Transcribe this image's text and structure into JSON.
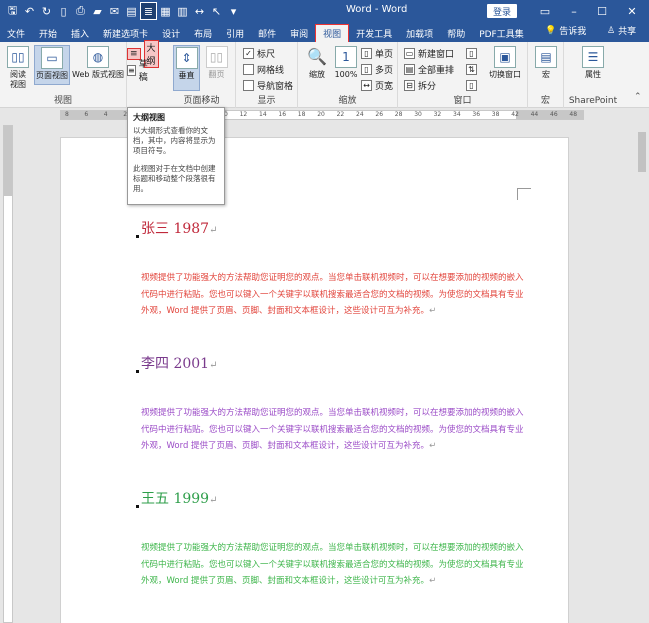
{
  "window": {
    "title": "Word - Word",
    "login_label": "登录",
    "controls": {
      "ribbon_options": "▭",
      "minimize": "–",
      "maximize": "☐",
      "close": "✕"
    }
  },
  "qat": [
    "save",
    "undo",
    "redo",
    "new",
    "print-preview",
    "open",
    "mail",
    "outline-view",
    "draft",
    "columns",
    "spacing",
    "select",
    "customize"
  ],
  "tabs": [
    "文件",
    "开始",
    "插入",
    "新建选项卡",
    "设计",
    "布局",
    "引用",
    "邮件",
    "审阅",
    "视图",
    "开发工具",
    "加载项",
    "帮助",
    "PDF工具集"
  ],
  "active_tab": "视图",
  "tab_right": {
    "tell_me": "告诉我",
    "share": "共享"
  },
  "ribbon": {
    "views": {
      "label": "视图",
      "read_mode": "阅读\n视图",
      "print_layout": "页面视图",
      "web_layout": "Web 版式视图",
      "outline": "大纲",
      "draft": "草稿"
    },
    "page_movement": {
      "label": "页面移动",
      "vertical": "垂直",
      "side_to_side": "翻页"
    },
    "show": {
      "label": "显示",
      "ruler": "标尺",
      "gridlines": "网格线",
      "nav_pane": "导航窗格",
      "ruler_checked": true
    },
    "zoom": {
      "label": "缩放",
      "zoom": "缩放",
      "percent": "100%",
      "one_page": "单页",
      "multi_page": "多页",
      "page_width": "页宽"
    },
    "window": {
      "label": "窗口",
      "new_window": "新建窗口",
      "arrange_all": "全部重排",
      "split": "拆分",
      "switch": "切换窗口"
    },
    "macros": {
      "label": "宏",
      "macros": "宏"
    },
    "sharepoint": {
      "label": "SharePoint",
      "properties": "属性"
    }
  },
  "ruler_ticks": [
    "8",
    "6",
    "4",
    "2",
    "2",
    "4",
    "6",
    "8",
    "10",
    "12",
    "14",
    "16",
    "18",
    "20",
    "22",
    "24",
    "26",
    "28",
    "30",
    "32",
    "34",
    "36",
    "38",
    "42",
    "44",
    "46",
    "48"
  ],
  "tooltip": {
    "title": "大纲视图",
    "p1": "以大纲形式查看你的文档，其中，内容将显示为项目符号。",
    "p2": "此视图对于在文档中创建标题和移动整个段落很有用。"
  },
  "document": {
    "sections": [
      {
        "heading": "张三 1987",
        "color": "#c0293b",
        "body": "视频提供了功能强大的方法帮助您证明您的观点。当您单击联机视频时，可以在想要添加的视频的嵌入代码中进行粘贴。您也可以键入一个关键字以联机搜索最适合您的文档的视频。为使您的文档具有专业外观，Word 提供了页眉、页脚、封面和文本框设计，这些设计可互为补充。",
        "body_color": "#e2453c"
      },
      {
        "heading": "李四 2001",
        "color": "#7a3a8c",
        "body": "视频提供了功能强大的方法帮助您证明您的观点。当您单击联机视频时，可以在想要添加的视频的嵌入代码中进行粘贴。您也可以键入一个关键字以联机搜索最适合您的文档的视频。为使您的文档具有专业外观，Word 提供了页眉、页脚、封面和文本框设计，这些设计可互为补充。",
        "body_color": "#9b4cc7"
      },
      {
        "heading": "王五 1999",
        "color": "#2e9e4a",
        "body": "视频提供了功能强大的方法帮助您证明您的观点。当您单击联机视频时，可以在想要添加的视频的嵌入代码中进行粘贴。您也可以键入一个关键字以联机搜索最适合您的文档的视频。为使您的文档具有专业外观，Word 提供了页眉、页脚、封面和文本框设计，这些设计可互为补充。",
        "body_color": "#3db54a"
      }
    ],
    "paragraph_mark": "↵"
  }
}
